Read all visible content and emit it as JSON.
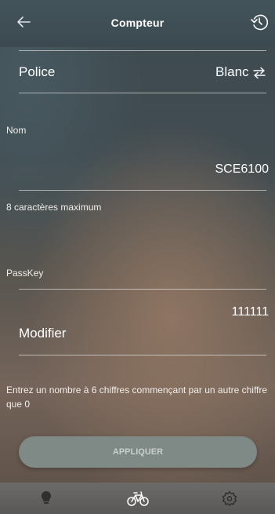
{
  "header": {
    "title": "Compteur",
    "back_icon": "arrow-left-icon",
    "history_icon": "history-icon"
  },
  "police": {
    "label": "Police",
    "value": "Blanc",
    "swap_icon": "swap-arrows-icon"
  },
  "nom": {
    "label": "Nom",
    "value": "SCE6100",
    "helper": "8 caractères maximum"
  },
  "passkey": {
    "label": "PassKey",
    "value": "111111"
  },
  "modifier": {
    "label": "Modifier",
    "hint": "Entrez un nombre à 6 chiffres commençant par un autre chiffre que 0"
  },
  "apply_button": {
    "label": "APPLIQUER"
  },
  "bottom_nav": {
    "items": [
      "lightbulb-icon",
      "bicycle-icon",
      "gear-icon"
    ],
    "active": "bicycle-icon"
  }
}
